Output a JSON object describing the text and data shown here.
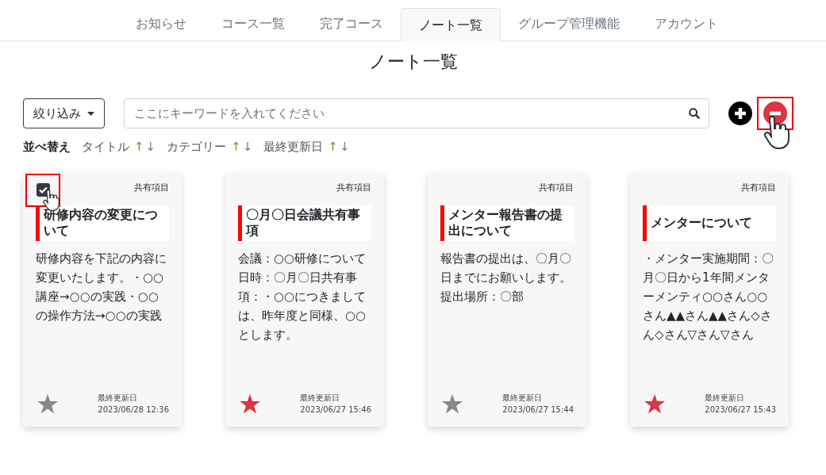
{
  "tabs": [
    {
      "label": "お知らせ",
      "selected": false
    },
    {
      "label": "コース一覧",
      "selected": false
    },
    {
      "label": "完了コース",
      "selected": false
    },
    {
      "label": "ノート一覧",
      "selected": true
    },
    {
      "label": "グループ管理機能",
      "selected": false
    },
    {
      "label": "アカウント",
      "selected": false
    }
  ],
  "page_title": "ノート一覧",
  "filter_button": "絞り込み",
  "search": {
    "placeholder": "ここにキーワードを入れてください"
  },
  "sort": {
    "label": "並べ替え",
    "keys": [
      {
        "label": "タイトル",
        "up": "↑",
        "down": "↓"
      },
      {
        "label": "カテゴリー",
        "up": "↑",
        "down": "↓"
      },
      {
        "label": "最終更新日",
        "up": "↑",
        "down": "↓"
      }
    ]
  },
  "notes": [
    {
      "checkbox": {
        "checked": true
      },
      "category": "共有項目",
      "title": "研修内容の変更について",
      "body": "研修内容を下記の内容に変更いたします。・○○講座→○○の実践・○○の操作方法→○○の実践",
      "favorite": false,
      "updated_label": "最終更新日",
      "updated": "2023/06/28 12:36"
    },
    {
      "category": "共有項目",
      "title": "〇月〇日会議共有事項",
      "body": "会議：○○研修について日時：〇月〇日共有事項：・○○につきましては、昨年度と同様、○○とします。",
      "favorite": true,
      "updated_label": "最終更新日",
      "updated": "2023/06/27 15:46"
    },
    {
      "category": "共有項目",
      "title": "メンター報告書の提出について",
      "body": "報告書の提出は、〇月〇日までにお願いします。提出場所：〇部",
      "favorite": false,
      "updated_label": "最終更新日",
      "updated": "2023/06/27 15:44"
    },
    {
      "category": "共有項目",
      "title": "メンターについて",
      "body": "・メンター実施期間：〇月〇日から1年間メンターメンティ○○さん○○さん▲▲さん▲▲さん◇さん◇さん▽さん▽さん",
      "favorite": true,
      "updated_label": "最終更新日",
      "updated": "2023/06/27 15:43"
    }
  ]
}
